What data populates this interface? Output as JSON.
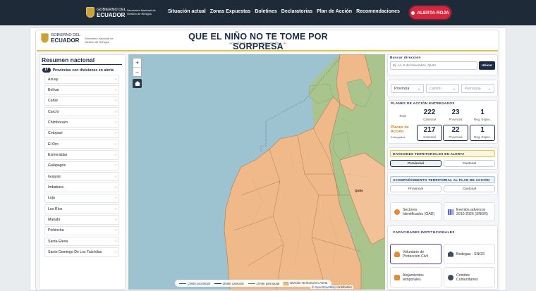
{
  "topnav": {
    "gov_logo": {
      "line1": "GOBIERNO DEL",
      "line2": "ECUADOR"
    },
    "secretariat": "Secretaría Nacional de Gestión de Riesgos",
    "links": [
      "Situación actual",
      "Zonas Expuestas",
      "Boletines",
      "Declaratorias",
      "Plan de Acción",
      "Recomendaciones"
    ],
    "alert_button": "ALERTA ROJA",
    "alert_color": "#d7263d"
  },
  "header": {
    "gov_logo": {
      "line1": "GOBIERNO DEL",
      "line2": "ECUADOR"
    },
    "secretariat": "Secretaría Nacional de Gestión de Riesgos",
    "title": "QUE EL NIÑO NO TE TOME POR SORPRESA",
    "updated": "Actualizado: 05 sept 2026, 02:19 p. m."
  },
  "summary": {
    "title": "Resumen nacional",
    "count": "17",
    "count_label": "Provincias con divisiones en alerta",
    "provinces": [
      "Azuay",
      "Bolívar",
      "Cañar",
      "Carchi",
      "Chimborazo",
      "Cotopaxi",
      "El Oro",
      "Esmeraldas",
      "Galápagos",
      "Guayas",
      "Imbabura",
      "Loja",
      "Los Ríos",
      "Manabí",
      "Pichincha",
      "Santa Elena",
      "Santo Domingo De Los Tsáchilas"
    ]
  },
  "map": {
    "zoom_in": "+",
    "zoom_out": "−",
    "place_label": "Quito",
    "legend": [
      "Límite provincial",
      "Límite cantonal",
      "Límite parroquial",
      "División Territorial en Alerta"
    ],
    "attribution_prefix": "© ",
    "attribution_link": "OpenStreetMap",
    "attribution_suffix": " contributors",
    "colors": {
      "sea": "#9dc2d0",
      "land_alert": "#f0b98a",
      "land_other": "#a9c48c"
    }
  },
  "search": {
    "label": "Buscar dirección",
    "placeholder": "Ej: Av. 6 de Diciembre, Quito",
    "button": "Ubicar"
  },
  "filters": {
    "province": "Provincia",
    "canton": "Cantón",
    "parish": "Parroquia"
  },
  "plans": {
    "title": "PLANES DE ACCIÓN ENTREGADOS",
    "total_label": "Total",
    "total": [
      {
        "value": "222",
        "label": "Cantonal"
      },
      {
        "value": "23",
        "label": "Provincial"
      },
      {
        "value": "1",
        "label": "Reg. Espec."
      }
    ],
    "delivered_label": "Planes de Acción",
    "delivered_sub": "Entregados",
    "delivered": [
      {
        "value": "217",
        "label": "Cantonal"
      },
      {
        "value": "22",
        "label": "Provincial"
      },
      {
        "value": "1",
        "label": "Reg. Espec."
      }
    ]
  },
  "divisions": {
    "title": "DIVISIONES TERRITORIALES EN ALERTA",
    "options": [
      "Provincial",
      "Cantonal"
    ]
  },
  "accompaniment": {
    "title": "ACOMPAÑAMIENTO TERRITORIAL AL PLAN DE ACCIÓN",
    "options": [
      "Provincial",
      "Cantonal"
    ]
  },
  "layers": {
    "sectors": "Sectores Identificados (GAD)",
    "events": "Eventos adversos 2010-2026 (SNGR)"
  },
  "capacities": {
    "title": "CAPACIDADES INSTITUCIONALES",
    "items": [
      "Voluntario de Protección Civil",
      "Bodegas - SNGR",
      "Alojamientos temporales",
      "Comités Comunitarios"
    ]
  }
}
